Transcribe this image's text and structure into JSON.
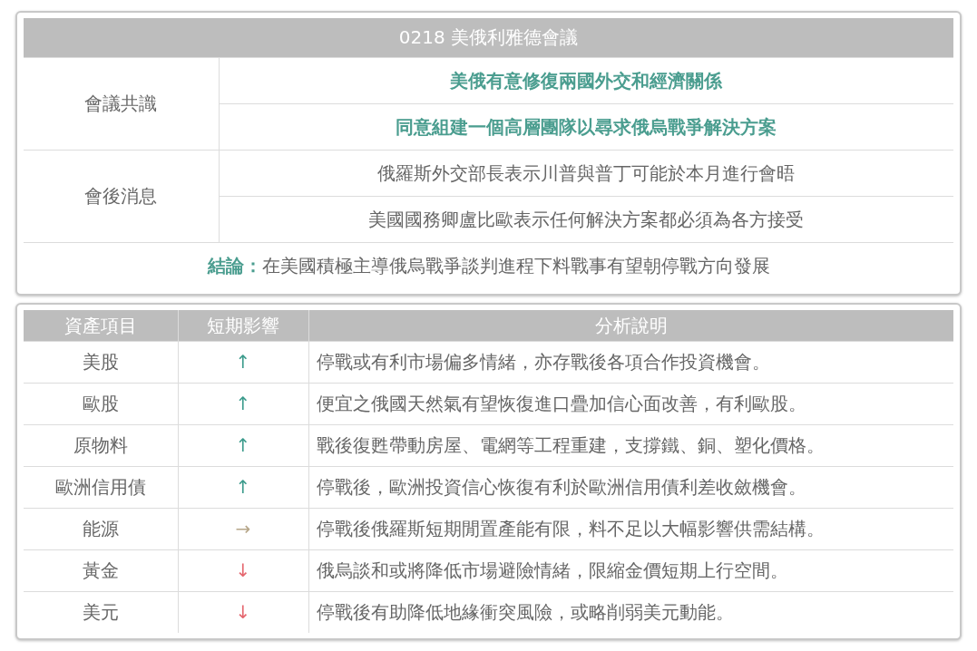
{
  "meeting_table": {
    "title": "0218 美俄利雅德會議",
    "groups": [
      {
        "label": "會議共識",
        "kind": "consensus",
        "items": [
          "美俄有意修復兩國外交和經濟關係",
          "同意組建一個高層團隊以尋求俄烏戰爭解決方案"
        ]
      },
      {
        "label": "會後消息",
        "kind": "news",
        "items": [
          "俄羅斯外交部長表示川普與普丁可能於本月進行會晤",
          "美國國務卿盧比歐表示任何解決方案都必須為各方接受"
        ]
      }
    ],
    "conclusion": {
      "label": "結論：",
      "text": "在美國積極主導俄烏戰爭談判進程下料戰事有望朝停戰方向發展"
    }
  },
  "asset_table": {
    "columns": [
      "資產項目",
      "短期影響",
      "分析說明"
    ],
    "rows": [
      {
        "asset": "美股",
        "impact": "↑",
        "kind": "up",
        "analysis": "停戰或有利市場偏多情緒，亦存戰後各項合作投資機會。"
      },
      {
        "asset": "歐股",
        "impact": "↑",
        "kind": "up",
        "analysis": "便宜之俄國天然氣有望恢復進口疊加信心面改善，有利歐股。"
      },
      {
        "asset": "原物料",
        "impact": "↑",
        "kind": "up",
        "analysis": "戰後復甦帶動房屋、電網等工程重建，支撐鐵、銅、塑化價格。"
      },
      {
        "asset": "歐洲信用債",
        "impact": "↑",
        "kind": "up",
        "analysis": "停戰後，歐洲投資信心恢復有利於歐洲信用債利差收斂機會。"
      },
      {
        "asset": "能源",
        "impact": "→",
        "kind": "flat",
        "analysis": "停戰後俄羅斯短期閒置產能有限，料不足以大幅影響供需結構。"
      },
      {
        "asset": "黃金",
        "impact": "↓",
        "kind": "down",
        "analysis": "俄烏談和或將降低市場避險情緒，限縮金價短期上行空間。"
      },
      {
        "asset": "美元",
        "impact": "↓",
        "kind": "down",
        "analysis": "停戰後有助降低地緣衝突風險，或略削弱美元動能。"
      }
    ]
  }
}
